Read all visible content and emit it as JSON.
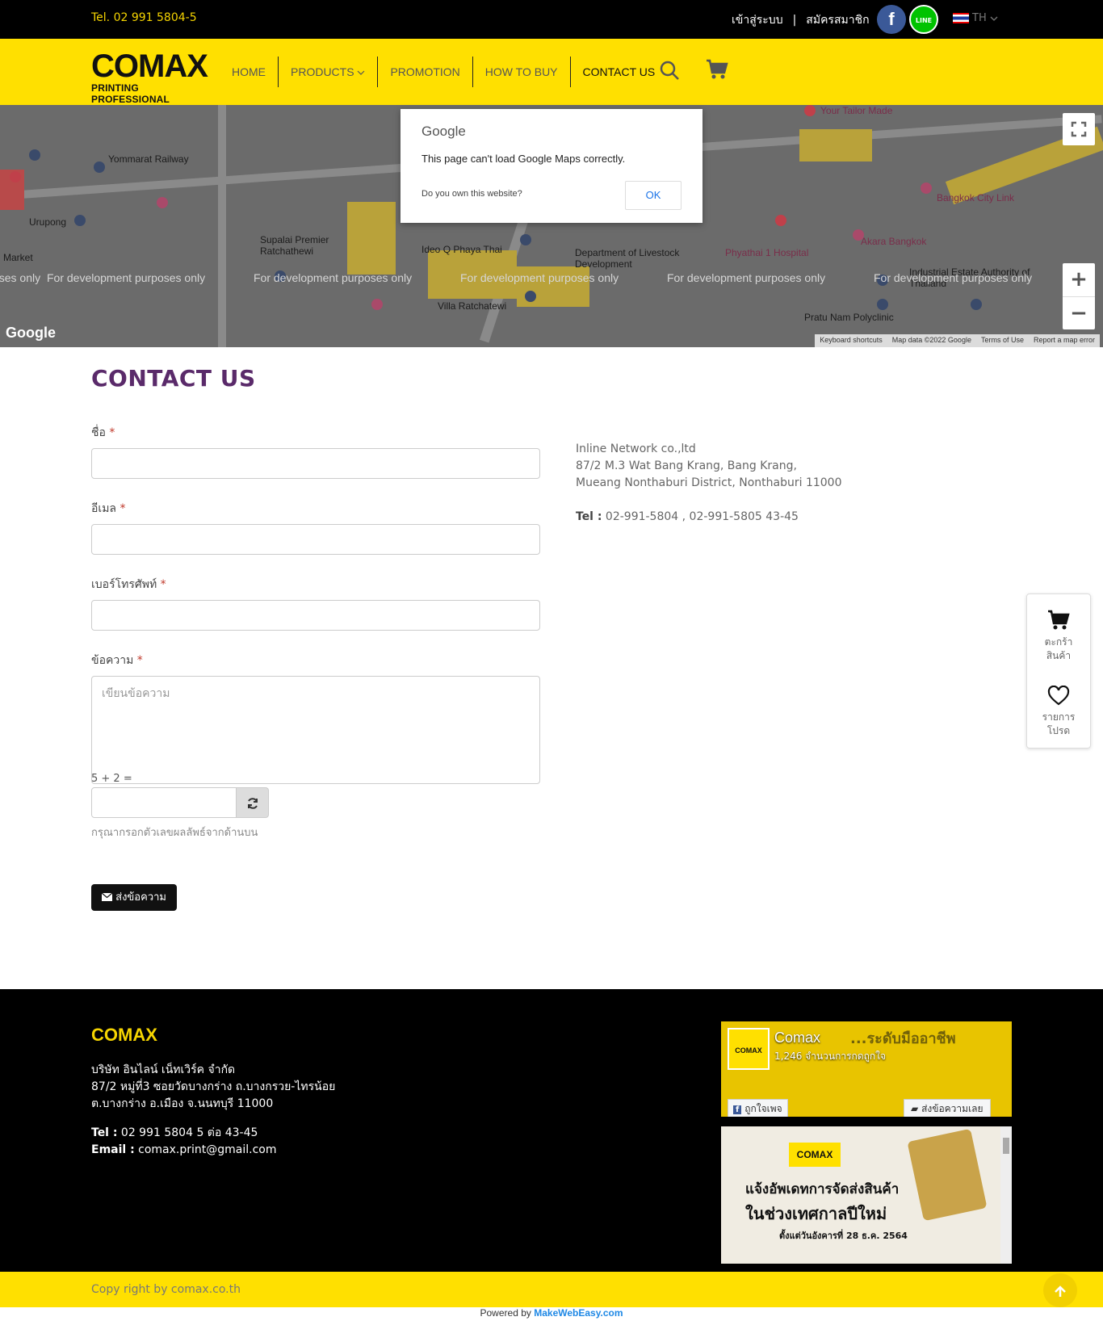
{
  "topbar": {
    "tel": "Tel. 02 991 5804-5",
    "login": "เข้าสู่ระบบ",
    "separator": "|",
    "register": "สมัครสมาชิก",
    "facebook_glyph": "f",
    "line_glyph": "LINE",
    "lang": "TH"
  },
  "brand": {
    "logo_main": "COMAX",
    "logo_sub": "PRINTING PROFESSIONAL",
    "color_yellow": "#ffe000",
    "color_black": "#000000"
  },
  "nav": {
    "items": [
      {
        "label": "HOME"
      },
      {
        "label": "PRODUCTS"
      },
      {
        "label": "PROMOTION"
      },
      {
        "label": "HOW TO BUY"
      },
      {
        "label": "CONTACT US"
      }
    ],
    "search_icon": "search-icon",
    "cart_icon": "cart-icon"
  },
  "map": {
    "dialog_brand": "Google",
    "dialog_message": "This page can't load Google Maps correctly.",
    "dialog_own": "Do you own this website?",
    "dialog_ok": "OK",
    "watermark": "For development purposes only",
    "google_logo": "Google",
    "attribution": [
      "Keyboard shortcuts",
      "Map data ©2022 Google",
      "Terms of Use",
      "Report a map error"
    ],
    "places": [
      "Yommarat Railway",
      "Urupong",
      "Market",
      "Supalai Premier Ratchathewi",
      "Ideo Q Phaya Thai",
      "Department of Livestock Development",
      "Villa Ratchatewi",
      "Phyathai 1 Hospital",
      "Akara Bangkok",
      "Bangkok City Link",
      "Your Tailor Made",
      "Pratu Nam Polyclinic",
      "Industrial Estate Authority of Thailand"
    ],
    "zoom_in": "+",
    "zoom_out": "−"
  },
  "page": {
    "title": "CONTACT US"
  },
  "form": {
    "name_label": "ชื่อ",
    "email_label": "อีเมล",
    "phone_label": "เบอร์โทรศัพท์",
    "message_label": "ข้อความ",
    "required_mark": "*",
    "message_placeholder": "เขียนข้อความ",
    "captcha_question": "5 + 2 =",
    "captcha_hint": "กรุณากรอกตัวเลขผลลัพธ์จากด้านบน",
    "submit_label": "ส่งข้อความ"
  },
  "contact_info": {
    "company": "Inline Network co.,ltd",
    "address1": "87/2 M.3 Wat Bang Krang, Bang Krang,",
    "address2": "Mueang Nonthaburi District, Nonthaburi 11000",
    "tel_label": "Tel :",
    "tel_value": "02-991-5804 , 02-991-5805 43-45"
  },
  "side_widget": {
    "cart_line1": "ตะกร้า",
    "cart_line2": "สินค้า",
    "wish_line1": "รายการ",
    "wish_line2": "โปรด"
  },
  "footer": {
    "brand": "COMAX",
    "company": "บริษัท อินไลน์ เน็ทเวิร์ค จำกัด",
    "address1": "87/2 หมู่ที่3 ซอยวัดบางกร่าง ถ.บางกรวย-ไทรน้อย",
    "address2": "ต.บางกร่าง อ.เมือง จ.นนทบุรี 11000",
    "tel_label": "Tel :",
    "tel_value": "02 991 5804 5 ต่อ 43-45",
    "email_label": "Email :",
    "email_value": "comax.print@gmail.com",
    "fb_name": "Comax",
    "fb_count": "1,246 จำนวนการกดถูกใจ",
    "fb_banner": "...ระดับมืออาชีพ",
    "fb_like": "ถูกใจเพจ",
    "fb_message": "ส่งข้อความเลย",
    "post_logo": "COMAX",
    "post_line1": "แจ้งอัพเดทการจัดส่งสินค้า",
    "post_line2": "ในช่วงเทศกาลปีใหม่",
    "post_line3": "ตั้งแต่วันอังคารที่ 28 ธ.ค. 2564",
    "copyright": "Copy right by comax.co.th",
    "powered_by": "Powered by",
    "powered_brand": "MakeWebEasy.com"
  }
}
